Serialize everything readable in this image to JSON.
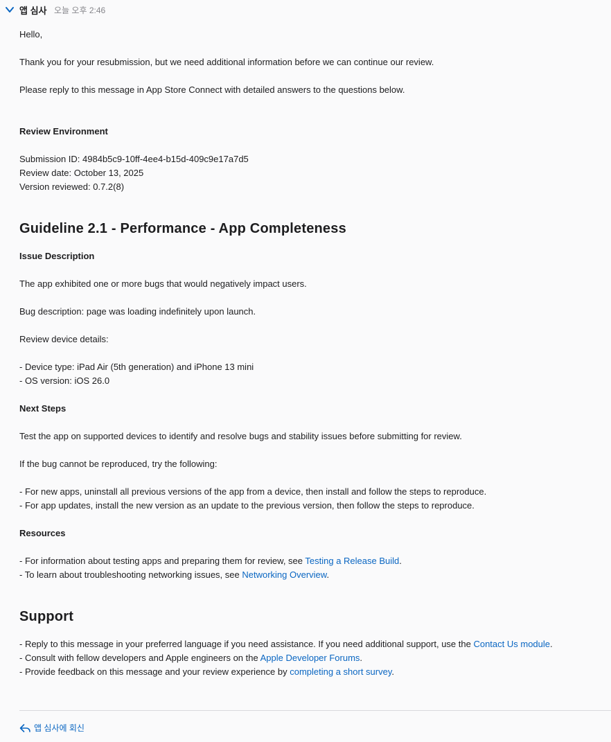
{
  "header": {
    "sender": "앱 심사",
    "time": "오늘 오후 2:46"
  },
  "message": {
    "greeting": "Hello,",
    "intro1": "Thank you for your resubmission, but we need additional information before we can continue our review.",
    "intro2": "Please reply to this message in App Store Connect with detailed answers to the questions below.",
    "env_heading": "Review Environment",
    "submission_id": "Submission ID: 4984b5c9-10ff-4ee4-b15d-409c9e17a7d5",
    "review_date": "Review date: October 13, 2025",
    "version_reviewed": "Version reviewed: 0.7.2(8)",
    "guideline_heading": "Guideline 2.1 - Performance - App Completeness",
    "issue_heading": "Issue Description",
    "issue_text": "The app exhibited one or more bugs that would negatively impact users.",
    "bug_description": "Bug description: page was loading indefinitely upon launch.",
    "device_details": "Review device details:",
    "device_type": "- Device type: iPad Air (5th generation) and iPhone 13 mini",
    "os_version": "- OS version: iOS 26.0",
    "next_heading": "Next Steps",
    "next_text": "Test the app on supported devices to identify and resolve bugs and stability issues before submitting for review.",
    "if_bug": "If the bug cannot be reproduced, try the following:",
    "new_apps": "- For new apps, uninstall all previous versions of the app from a device, then install and follow the steps to reproduce.",
    "app_updates": "- For app updates, install the new version as an update to the previous version, then follow the steps to reproduce.",
    "resources_heading": "Resources",
    "res1_prefix": "- For information about testing apps and preparing them for review, see ",
    "res1_link": "Testing a Release Build",
    "res1_suffix": ".",
    "res2_prefix": "- To learn about troubleshooting networking issues, see ",
    "res2_link": "Networking Overview",
    "res2_suffix": ".",
    "support_heading": "Support",
    "sup1_prefix": "- Reply to this message in your preferred language if you need assistance. If you need additional support, use the ",
    "sup1_link": "Contact Us module",
    "sup1_suffix": ".",
    "sup2_prefix": "- Consult with fellow developers and Apple engineers on the ",
    "sup2_link": "Apple Developer Forums",
    "sup2_suffix": ".",
    "sup3_prefix": "- Provide feedback on this message and your review experience by ",
    "sup3_link": "completing a short survey",
    "sup3_suffix": "."
  },
  "footer": {
    "reply_label": "앱 심사에 회신"
  },
  "colors": {
    "link": "#0a66c2",
    "text": "#1d1d1f",
    "muted": "#86868b",
    "background": "#fafafb"
  },
  "icons": {
    "collapse": "chevron-down-icon",
    "reply": "reply-arrow-icon"
  }
}
